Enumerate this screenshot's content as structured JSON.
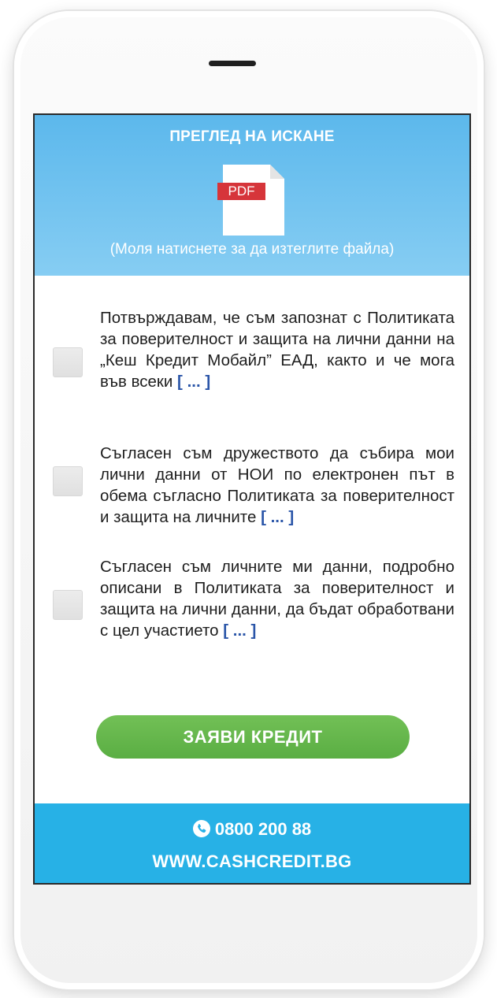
{
  "header": {
    "title": "ПРЕГЛЕД НА ИСКАНЕ",
    "pdf_label": "PDF",
    "download_hint": "(Моля натиснете за да изтеглите файла)"
  },
  "consents": [
    {
      "text": "Потвърждавам, че съм запознат с Политиката за поверителност и защита на лични данни на „Кеш Кредит Мобайл” ЕАД, както и че мога във всеки",
      "more": "[ ... ]",
      "checked": false
    },
    {
      "text": "Съгласен съм дружеството да събира мои лични данни от НОИ по електронен път в обема съгласно Политиката за поверителност и защита на личните",
      "more": "[ ... ]",
      "checked": false
    },
    {
      "text": "Съгласен съм личните ми данни, подробно описани в Политиката за поверителност и защита на лични данни, да бъдат обработвани с цел участието",
      "more": "[ ... ]",
      "checked": false
    }
  ],
  "apply_button": {
    "label": "ЗАЯВИ КРЕДИТ"
  },
  "footer": {
    "phone": "0800 200 88",
    "website": "WWW.CASHCREDIT.BG"
  },
  "icons": {
    "pdf": "pdf-file-icon",
    "phone": "phone-icon"
  },
  "colors": {
    "header_blue": "#5cb8ec",
    "footer_blue": "#27b1e6",
    "button_green": "#62b54b",
    "pdf_red": "#d6353a",
    "link_blue": "#2a55a8"
  }
}
